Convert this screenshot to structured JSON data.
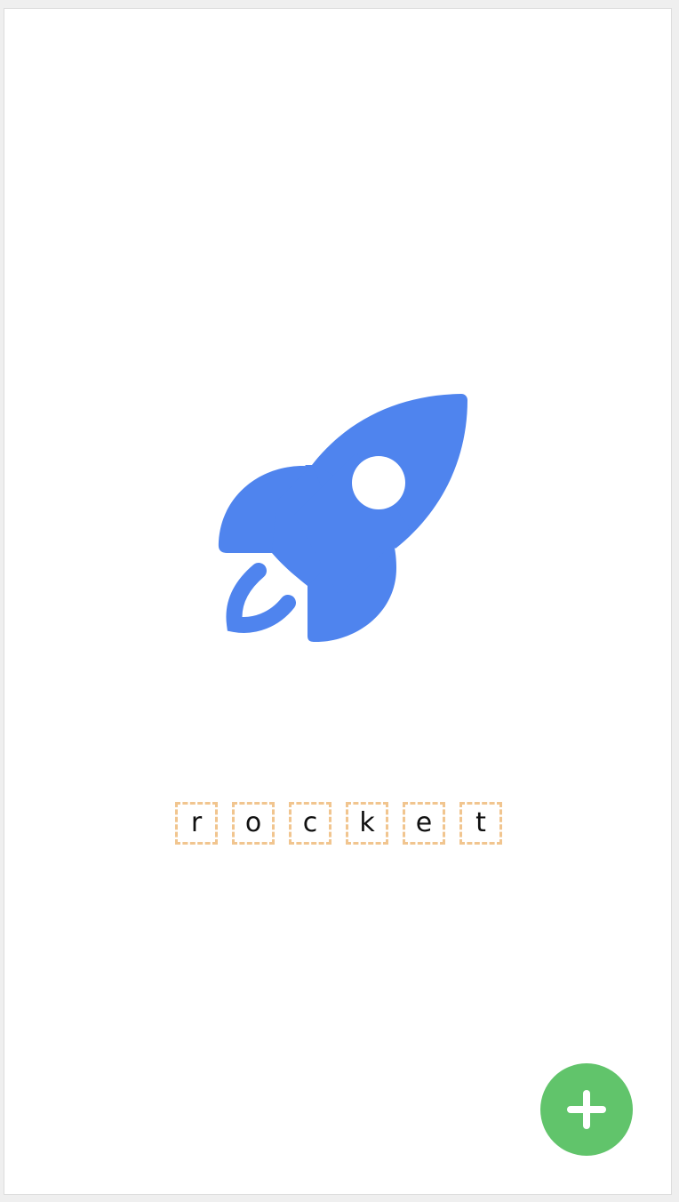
{
  "icon": {
    "name": "rocket-icon",
    "color": "#4f84ee"
  },
  "word": {
    "letters": [
      "r",
      "o",
      "c",
      "k",
      "e",
      "t"
    ],
    "box_border_color": "#f1c58f"
  },
  "fab": {
    "icon": "plus-icon",
    "color": "#61c46b"
  }
}
